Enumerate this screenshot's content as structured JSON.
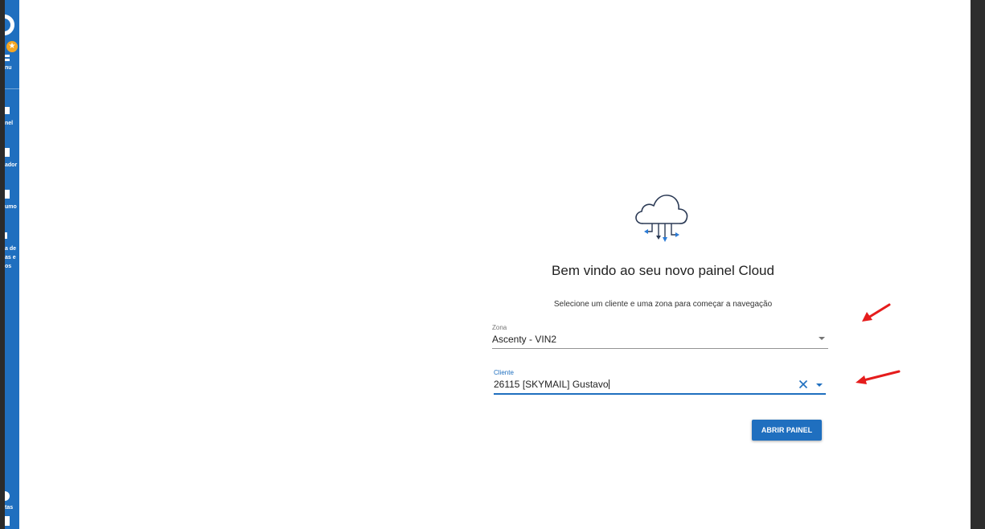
{
  "sidebar": {
    "items": [
      {
        "label": "nu"
      },
      {
        "label": "nel"
      },
      {
        "label": "ador"
      },
      {
        "label": "umo"
      },
      {
        "label": "a de\nas e\nos"
      },
      {
        "label": "tas"
      }
    ]
  },
  "welcome": {
    "title": "Bem vindo ao seu novo painel Cloud",
    "subtitle": "Selecione um cliente e uma zona para começar a navegação"
  },
  "zona": {
    "label": "Zona",
    "value": "Ascenty - VIN2"
  },
  "cliente": {
    "label": "Cliente",
    "value": "26115 [SKYMAIL] Gustavo"
  },
  "actions": {
    "open_panel_label": "ABRIR PAINEL"
  },
  "icons": {
    "cloud": "cloud-sync-icon",
    "clear": "close-icon",
    "dropdown": "arrow-drop-down-icon",
    "annotation": "red-arrow-annotation"
  },
  "colors": {
    "primary": "#1f6fbf",
    "annotation": "#e51c1c",
    "star": "#f5a623"
  }
}
